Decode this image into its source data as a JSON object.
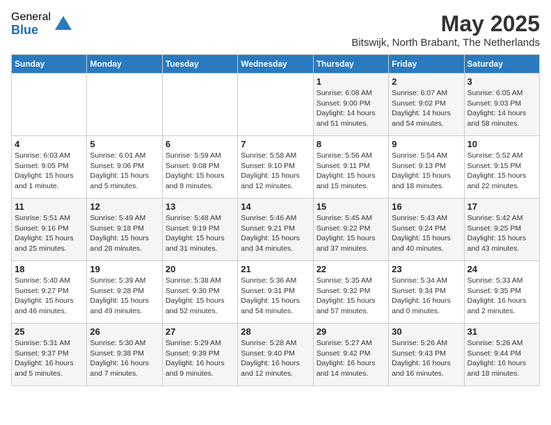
{
  "logo": {
    "general": "General",
    "blue": "Blue"
  },
  "title": "May 2025",
  "location": "Bitswijk, North Brabant, The Netherlands",
  "days_header": [
    "Sunday",
    "Monday",
    "Tuesday",
    "Wednesday",
    "Thursday",
    "Friday",
    "Saturday"
  ],
  "weeks": [
    [
      {
        "day": "",
        "info": ""
      },
      {
        "day": "",
        "info": ""
      },
      {
        "day": "",
        "info": ""
      },
      {
        "day": "",
        "info": ""
      },
      {
        "day": "1",
        "info": "Sunrise: 6:08 AM\nSunset: 9:00 PM\nDaylight: 14 hours\nand 51 minutes."
      },
      {
        "day": "2",
        "info": "Sunrise: 6:07 AM\nSunset: 9:02 PM\nDaylight: 14 hours\nand 54 minutes."
      },
      {
        "day": "3",
        "info": "Sunrise: 6:05 AM\nSunset: 9:03 PM\nDaylight: 14 hours\nand 58 minutes."
      }
    ],
    [
      {
        "day": "4",
        "info": "Sunrise: 6:03 AM\nSunset: 9:05 PM\nDaylight: 15 hours\nand 1 minute."
      },
      {
        "day": "5",
        "info": "Sunrise: 6:01 AM\nSunset: 9:06 PM\nDaylight: 15 hours\nand 5 minutes."
      },
      {
        "day": "6",
        "info": "Sunrise: 5:59 AM\nSunset: 9:08 PM\nDaylight: 15 hours\nand 8 minutes."
      },
      {
        "day": "7",
        "info": "Sunrise: 5:58 AM\nSunset: 9:10 PM\nDaylight: 15 hours\nand 12 minutes."
      },
      {
        "day": "8",
        "info": "Sunrise: 5:56 AM\nSunset: 9:11 PM\nDaylight: 15 hours\nand 15 minutes."
      },
      {
        "day": "9",
        "info": "Sunrise: 5:54 AM\nSunset: 9:13 PM\nDaylight: 15 hours\nand 18 minutes."
      },
      {
        "day": "10",
        "info": "Sunrise: 5:52 AM\nSunset: 9:15 PM\nDaylight: 15 hours\nand 22 minutes."
      }
    ],
    [
      {
        "day": "11",
        "info": "Sunrise: 5:51 AM\nSunset: 9:16 PM\nDaylight: 15 hours\nand 25 minutes."
      },
      {
        "day": "12",
        "info": "Sunrise: 5:49 AM\nSunset: 9:18 PM\nDaylight: 15 hours\nand 28 minutes."
      },
      {
        "day": "13",
        "info": "Sunrise: 5:48 AM\nSunset: 9:19 PM\nDaylight: 15 hours\nand 31 minutes."
      },
      {
        "day": "14",
        "info": "Sunrise: 5:46 AM\nSunset: 9:21 PM\nDaylight: 15 hours\nand 34 minutes."
      },
      {
        "day": "15",
        "info": "Sunrise: 5:45 AM\nSunset: 9:22 PM\nDaylight: 15 hours\nand 37 minutes."
      },
      {
        "day": "16",
        "info": "Sunrise: 5:43 AM\nSunset: 9:24 PM\nDaylight: 15 hours\nand 40 minutes."
      },
      {
        "day": "17",
        "info": "Sunrise: 5:42 AM\nSunset: 9:25 PM\nDaylight: 15 hours\nand 43 minutes."
      }
    ],
    [
      {
        "day": "18",
        "info": "Sunrise: 5:40 AM\nSunset: 9:27 PM\nDaylight: 15 hours\nand 46 minutes."
      },
      {
        "day": "19",
        "info": "Sunrise: 5:39 AM\nSunset: 9:28 PM\nDaylight: 15 hours\nand 49 minutes."
      },
      {
        "day": "20",
        "info": "Sunrise: 5:38 AM\nSunset: 9:30 PM\nDaylight: 15 hours\nand 52 minutes."
      },
      {
        "day": "21",
        "info": "Sunrise: 5:36 AM\nSunset: 9:31 PM\nDaylight: 15 hours\nand 54 minutes."
      },
      {
        "day": "22",
        "info": "Sunrise: 5:35 AM\nSunset: 9:32 PM\nDaylight: 15 hours\nand 57 minutes."
      },
      {
        "day": "23",
        "info": "Sunrise: 5:34 AM\nSunset: 9:34 PM\nDaylight: 16 hours\nand 0 minutes."
      },
      {
        "day": "24",
        "info": "Sunrise: 5:33 AM\nSunset: 9:35 PM\nDaylight: 16 hours\nand 2 minutes."
      }
    ],
    [
      {
        "day": "25",
        "info": "Sunrise: 5:31 AM\nSunset: 9:37 PM\nDaylight: 16 hours\nand 5 minutes."
      },
      {
        "day": "26",
        "info": "Sunrise: 5:30 AM\nSunset: 9:38 PM\nDaylight: 16 hours\nand 7 minutes."
      },
      {
        "day": "27",
        "info": "Sunrise: 5:29 AM\nSunset: 9:39 PM\nDaylight: 16 hours\nand 9 minutes."
      },
      {
        "day": "28",
        "info": "Sunrise: 5:28 AM\nSunset: 9:40 PM\nDaylight: 16 hours\nand 12 minutes."
      },
      {
        "day": "29",
        "info": "Sunrise: 5:27 AM\nSunset: 9:42 PM\nDaylight: 16 hours\nand 14 minutes."
      },
      {
        "day": "30",
        "info": "Sunrise: 5:26 AM\nSunset: 9:43 PM\nDaylight: 16 hours\nand 16 minutes."
      },
      {
        "day": "31",
        "info": "Sunrise: 5:26 AM\nSunset: 9:44 PM\nDaylight: 16 hours\nand 18 minutes."
      }
    ]
  ]
}
